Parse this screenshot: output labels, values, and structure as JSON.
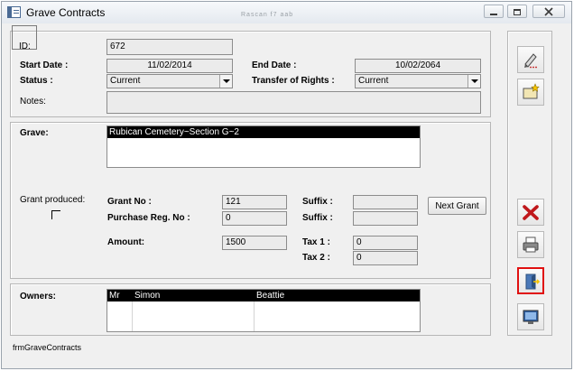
{
  "window": {
    "title": "Grave Contracts",
    "faint_text": "Rascan f7   aab",
    "controls": [
      "minimize",
      "restore",
      "close"
    ]
  },
  "contract": {
    "id_label": "ID:",
    "id_value": "672",
    "start_date_label": "Start Date :",
    "start_date_value": "11/02/2014",
    "end_date_label": "End Date :",
    "end_date_value": "10/02/2064",
    "status_label": "Status :",
    "status_value": "Current",
    "transfer_label": "Transfer of Rights :",
    "transfer_value": "Current",
    "notes_label": "Notes:",
    "notes_value": ""
  },
  "grave": {
    "label": "Grave:",
    "selected": "Rubican Cemetery~Section G~2"
  },
  "grant": {
    "produced_label": "Grant produced:",
    "produced_checked": false,
    "grant_no_label": "Grant No :",
    "grant_no_value": "121",
    "suffix_label_1": "Suffix :",
    "suffix_value_1": "",
    "purchase_label": "Purchase Reg. No :",
    "purchase_value": "0",
    "suffix_label_2": "Suffix :",
    "suffix_value_2": "",
    "next_grant_button": "Next Grant",
    "amount_label": "Amount:",
    "amount_value": "1500",
    "tax1_label": "Tax 1 :",
    "tax1_value": "0",
    "tax2_label": "Tax 2 :",
    "tax2_value": "0"
  },
  "owners": {
    "label": "Owners:",
    "rows": [
      {
        "title": "Mr",
        "first": "Simon",
        "last": "Beattie"
      }
    ]
  },
  "sidebar": {
    "buttons": [
      "edit-icon",
      "new-record-icon",
      "delete-icon",
      "print-icon",
      "exit-door-icon",
      "screen-icon"
    ],
    "active": "exit-door-icon"
  },
  "footer": {
    "form_name": "frmGraveContracts"
  },
  "colors": {
    "selection_bg": "#000000",
    "delete_red": "#c0181c",
    "active_border": "#e01010"
  }
}
